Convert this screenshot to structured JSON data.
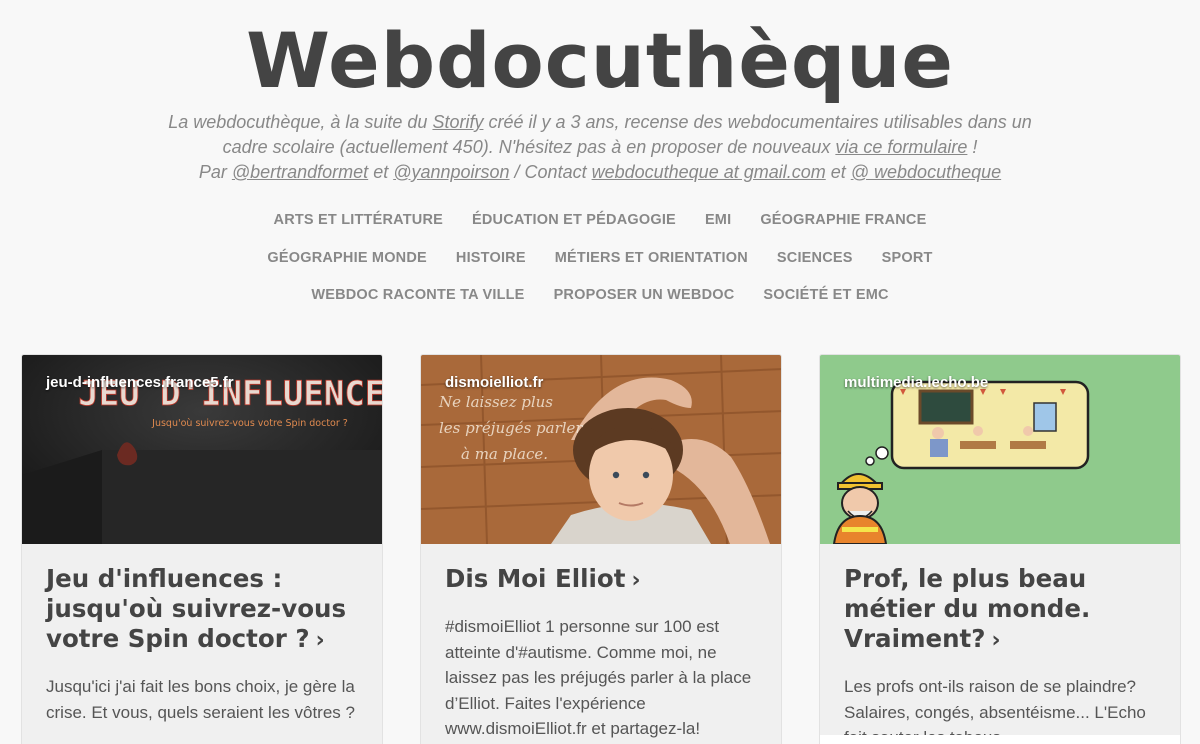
{
  "site": {
    "title": "Webdocuthèque",
    "intro": {
      "p1": "La webdocuthèque, à la suite du ",
      "storify": "Storify",
      "p2": " créé il y a 3 ans, recense des webdocumentaires utilisables dans un cadre scolaire (actuellement 450). N'hésitez pas à en proposer de nouveaux ",
      "form_link": "via ce formulaire",
      "p3": " !",
      "par": "Par ",
      "author1": "@bertrandformet",
      "et1": " et ",
      "author2": "@yannpoirson",
      "contact": " / Contact ",
      "email": "webdocutheque at gmail.com",
      "et2": " et ",
      "twitter": "@ webdocutheque"
    }
  },
  "nav": {
    "row1": [
      "Arts et littérature",
      "Éducation et pédagogie",
      "EMI",
      "Géographie France"
    ],
    "row2": [
      "Géographie monde",
      "Histoire",
      "Métiers et orientation",
      "Sciences",
      "Sport"
    ],
    "row3": [
      "Webdoc raconte ta ville",
      "Proposer un webdoc",
      "Société et EMC"
    ]
  },
  "cards": [
    {
      "domain": "jeu-d-influences.france5.fr",
      "thumb_title": "JEU D'INFLUENCES",
      "thumb_sub": "Jusqu'où suivrez-vous votre Spin doctor ?",
      "title": "Jeu d'influences : jusqu'où suivrez-vous votre Spin doctor ?",
      "text": "Jusqu'ici j'ai fait les bons choix, je gère la crise. Et vous, quels seraient les vôtres ?"
    },
    {
      "domain": "dismoielliot.fr",
      "thumb_line1": "Ne laissez plus",
      "thumb_line2": "les préjugés parler",
      "thumb_line3": "à ma place.",
      "title": "Dis Moi Elliot",
      "text": "#dismoiElliot 1 personne sur 100 est atteinte d'#autisme. Comme moi, ne laissez pas les préjugés parler à la place d’Elliot. Faites l'expérience www.dismoiElliot.fr et partagez-la!"
    },
    {
      "domain": "multimedia.lecho.be",
      "title": "Prof, le plus beau métier du monde. Vraiment?",
      "text": "Les profs ont-ils raison de se plaindre? Salaires, congés, absentéisme... L'Echo fait sauter les tabous"
    }
  ],
  "icons": {
    "chevron": "chevron-right-icon"
  },
  "colors": {
    "background": "#f8f8f8",
    "title": "#444444",
    "muted": "#888888",
    "card": "#f0f0f0"
  }
}
